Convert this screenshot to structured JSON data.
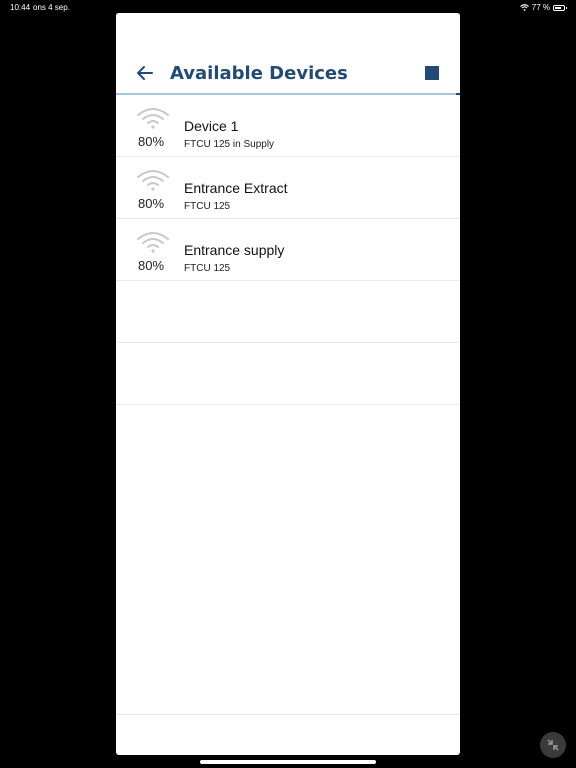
{
  "status_bar": {
    "time": "10:44",
    "date": "ons 4 sep.",
    "battery": "77 %",
    "battery_level": 0.77
  },
  "header": {
    "title": "Available Devices",
    "back_icon": "arrow-left-icon",
    "stop_icon": "stop-square-icon",
    "accent_color": "#234a75"
  },
  "devices": [
    {
      "name": "Device 1",
      "model": "FTCU 125 in Supply",
      "signal": "80%",
      "signal_level": 0.8
    },
    {
      "name": "Entrance Extract",
      "model": "FTCU 125",
      "signal": "80%",
      "signal_level": 0.8
    },
    {
      "name": "Entrance supply",
      "model": "FTCU 125",
      "signal": "80%",
      "signal_level": 0.8
    }
  ]
}
